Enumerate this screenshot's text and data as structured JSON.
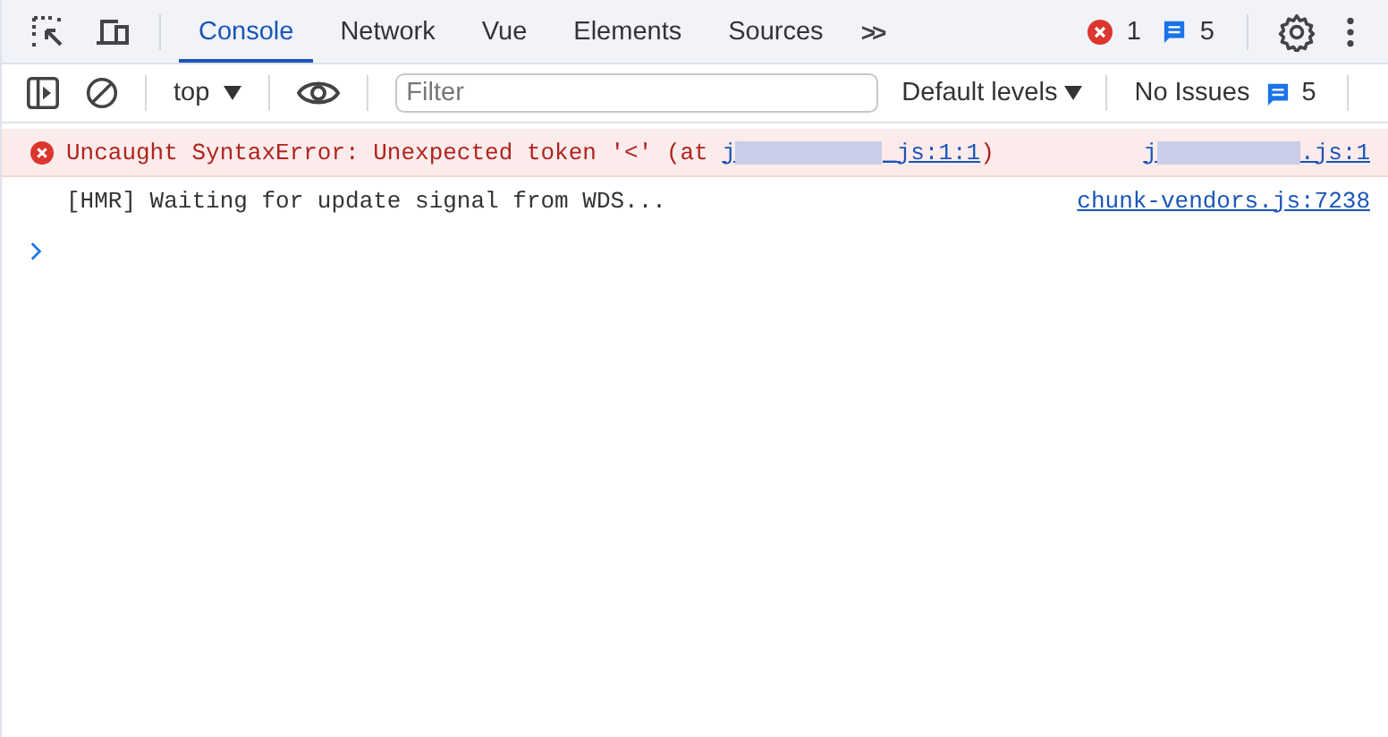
{
  "tabs": [
    {
      "label": "Console",
      "selected": true
    },
    {
      "label": "Network",
      "selected": false
    },
    {
      "label": "Vue",
      "selected": false
    },
    {
      "label": "Elements",
      "selected": false
    },
    {
      "label": "Sources",
      "selected": false
    }
  ],
  "more_tabs": ">>",
  "error_count": "1",
  "message_count": "5",
  "console_toolbar": {
    "context": "top",
    "filter": {
      "placeholder": "Filter"
    },
    "levels": "Default levels",
    "issues": "No Issues",
    "issues_count": "5"
  },
  "messages": [
    {
      "kind": "error",
      "text": "Uncaught SyntaxError: Unexpected token '<' (at ",
      "link": {
        "prefix": "j",
        "suffix": "_js:1:1"
      },
      "after": ")",
      "source": {
        "prefix": "j",
        "suffix": ".js:1"
      }
    },
    {
      "kind": "log",
      "text": "[HMR] Waiting for update signal from WDS...",
      "source": {
        "prefix": "chunk-vendors.js:7238"
      }
    }
  ]
}
